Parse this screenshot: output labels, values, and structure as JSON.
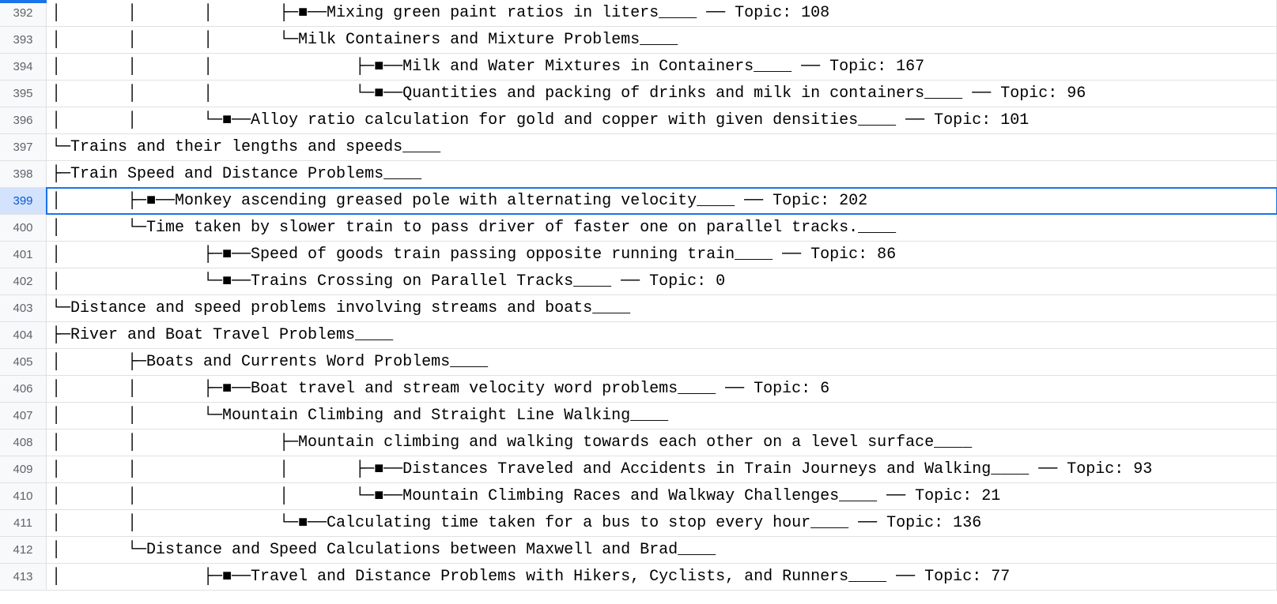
{
  "rows": [
    {
      "num": "392",
      "text": "│       │       │       ├─■──Mixing green paint ratios in liters____ ── Topic: 108"
    },
    {
      "num": "393",
      "text": "│       │       │       └─Milk Containers and Mixture Problems____"
    },
    {
      "num": "394",
      "text": "│       │       │               ├─■──Milk and Water Mixtures in Containers____ ── Topic: 167"
    },
    {
      "num": "395",
      "text": "│       │       │               └─■──Quantities and packing of drinks and milk in containers____ ── Topic: 96"
    },
    {
      "num": "396",
      "text": "│       │       └─■──Alloy ratio calculation for gold and copper with given densities____ ── Topic: 101"
    },
    {
      "num": "397",
      "text": "└─Trains and their lengths and speeds____"
    },
    {
      "num": "398",
      "text": "├─Train Speed and Distance Problems____"
    },
    {
      "num": "399",
      "text": "│       ├─■──Monkey ascending greased pole with alternating velocity____ ── Topic: 202",
      "selected": true
    },
    {
      "num": "400",
      "text": "│       └─Time taken by slower train to pass driver of faster one on parallel tracks.____"
    },
    {
      "num": "401",
      "text": "│               ├─■──Speed of goods train passing opposite running train____ ── Topic: 86"
    },
    {
      "num": "402",
      "text": "│               └─■──Trains Crossing on Parallel Tracks____ ── Topic: 0"
    },
    {
      "num": "403",
      "text": "└─Distance and speed problems involving streams and boats____"
    },
    {
      "num": "404",
      "text": "├─River and Boat Travel Problems____"
    },
    {
      "num": "405",
      "text": "│       ├─Boats and Currents Word Problems____"
    },
    {
      "num": "406",
      "text": "│       │       ├─■──Boat travel and stream velocity word problems____ ── Topic: 6"
    },
    {
      "num": "407",
      "text": "│       │       └─Mountain Climbing and Straight Line Walking____"
    },
    {
      "num": "408",
      "text": "│       │               ├─Mountain climbing and walking towards each other on a level surface____"
    },
    {
      "num": "409",
      "text": "│       │               │       ├─■──Distances Traveled and Accidents in Train Journeys and Walking____ ── Topic: 93"
    },
    {
      "num": "410",
      "text": "│       │               │       └─■──Mountain Climbing Races and Walkway Challenges____ ── Topic: 21"
    },
    {
      "num": "411",
      "text": "│       │               └─■──Calculating time taken for a bus to stop every hour____ ── Topic: 136"
    },
    {
      "num": "412",
      "text": "│       └─Distance and Speed Calculations between Maxwell and Brad____"
    },
    {
      "num": "413",
      "text": "│               ├─■──Travel and Distance Problems with Hikers, Cyclists, and Runners____ ── Topic: 77"
    }
  ]
}
